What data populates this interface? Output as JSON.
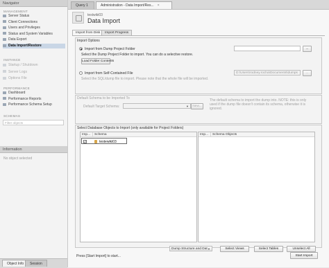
{
  "sidebar": {
    "navigator_title": "Navigator",
    "management_title": "MANAGEMENT",
    "management_items": [
      {
        "label": "Server Status",
        "icon": "server-status-icon",
        "state": "normal"
      },
      {
        "label": "Client Connections",
        "icon": "connections-icon",
        "state": "normal"
      },
      {
        "label": "Users and Privileges",
        "icon": "users-icon",
        "state": "normal"
      },
      {
        "label": "Status and System Variables",
        "icon": "variables-icon",
        "state": "normal"
      },
      {
        "label": "Data Export",
        "icon": "export-icon",
        "state": "normal"
      },
      {
        "label": "Data Import/Restore",
        "icon": "import-icon",
        "state": "active"
      }
    ],
    "instance_title": "INSTANCE",
    "instance_items": [
      {
        "label": "Startup / Shutdown",
        "icon": "startup-icon"
      },
      {
        "label": "Server Logs",
        "icon": "logs-icon"
      },
      {
        "label": "Options File",
        "icon": "options-file-icon"
      }
    ],
    "performance_title": "PERFORMANCE",
    "performance_items": [
      {
        "label": "Dashboard",
        "icon": "dashboard-icon"
      },
      {
        "label": "Performance Reports",
        "icon": "reports-icon"
      },
      {
        "label": "Performance Schema Setup",
        "icon": "schema-setup-icon"
      }
    ],
    "schemas_title": "SCHEMAS",
    "filter_placeholder": "Filter objects",
    "information_title": "Information",
    "information_text": "No object selected",
    "bottom_tabs": [
      "Object Info",
      "Session"
    ]
  },
  "top_tabs": [
    {
      "label": "Query 1",
      "active": false
    },
    {
      "label": "Administration - Data Import/Res...",
      "active": true
    }
  ],
  "header": {
    "subtitle": "testwiki03",
    "title": "Data Import"
  },
  "inner_tabs": [
    "Import from Disk",
    "Import Progress"
  ],
  "import_options": {
    "group_title": "Import Options",
    "dump_folder_label": "Import from Dump Project Folder",
    "dump_folder_value": "",
    "browse_label": "...",
    "dump_folder_hint": "Select the Dump Project Folder to import. You can do a selective restore.",
    "load_folder_label": "Load Folder Contents",
    "self_contained_label": "Import from Self-Contained File",
    "self_contained_value": "D:\\Users\\rodney.rocha\\Documents\\dumps",
    "self_contained_hint": "Select the SQL/dump file to import. Please note that the whole file will be imported."
  },
  "default_schema": {
    "group_title": "Default Schema to be Imported To",
    "target_label": "Default Target Schema:",
    "target_value": "",
    "new_button": "New...",
    "note": "The default schema to import the dump into. NOTE: this is only used if the dump file doesn't contain its schema, otherwise it is ignored."
  },
  "objects": {
    "group_title": "Select Database Objects to Import (only available for Project Folders)",
    "left_headers": [
      "Imp...",
      "Schema"
    ],
    "schemas": [
      {
        "name": "testewiki03",
        "checked": true,
        "check_mark": "✓"
      }
    ],
    "right_headers": [
      "Imp...",
      "Schema Objects"
    ],
    "dump_select": "Dump Structure and Dat",
    "dropdown_arrow": "▼",
    "select_views": "Select Views",
    "select_tables": "Select Tables",
    "unselect_all": "Unselect All"
  },
  "footer": {
    "status": "Press [Start Import] to start...",
    "start_button": "Start Import"
  }
}
